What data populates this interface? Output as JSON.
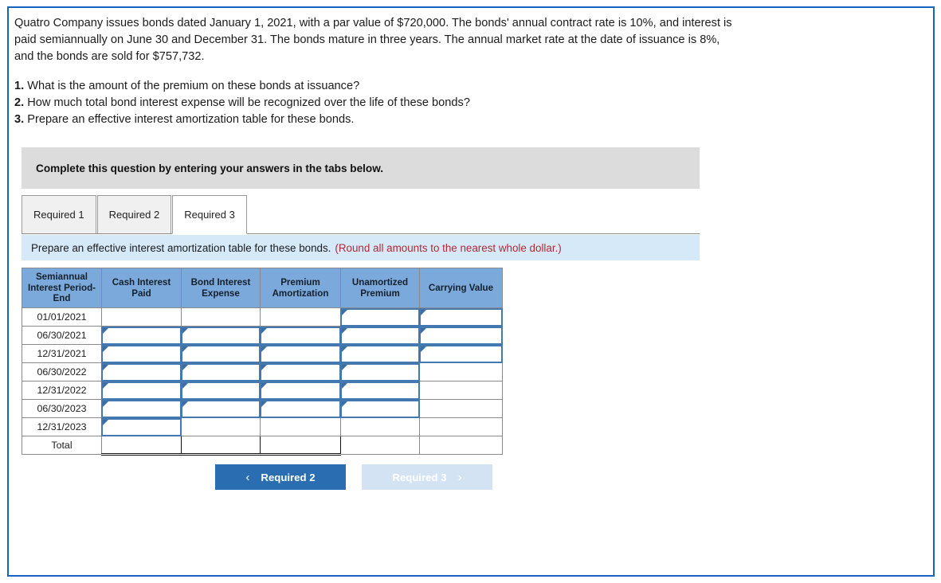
{
  "problem": {
    "statement": "Quatro Company issues bonds dated January 1, 2021, with a par value of $720,000. The bonds' annual contract rate is 10%, and interest is paid semiannually on June 30 and December 31. The bonds mature in three years. The annual market rate at the date of issuance is 8%, and the bonds are sold for $757,732.",
    "questions": [
      {
        "num": "1.",
        "text": "What is the amount of the premium on these bonds at issuance?"
      },
      {
        "num": "2.",
        "text": "How much total bond interest expense will be recognized over the life of these bonds?"
      },
      {
        "num": "3.",
        "text": "Prepare an effective interest amortization table for these bonds."
      }
    ]
  },
  "instruction_banner": {
    "text": "Complete this question by entering your answers in the tabs below."
  },
  "tabs": [
    {
      "label": "Required 1",
      "active": false
    },
    {
      "label": "Required 2",
      "active": false
    },
    {
      "label": "Required 3",
      "active": true
    }
  ],
  "info_bar": {
    "text": "Prepare an effective interest amortization table for these bonds.",
    "note": "(Round all amounts to the nearest whole dollar.)"
  },
  "table": {
    "headers": [
      "Semiannual Interest Period-End",
      "Cash Interest Paid",
      "Bond Interest Expense",
      "Premium Amortization",
      "Unamortized Premium",
      "Carrying Value"
    ],
    "rows": [
      {
        "period": "01/01/2021",
        "cells": [
          "",
          "",
          "",
          "",
          ""
        ],
        "inputs": [
          false,
          false,
          false,
          true,
          true
        ]
      },
      {
        "period": "06/30/2021",
        "cells": [
          "",
          "",
          "",
          "",
          ""
        ],
        "inputs": [
          true,
          true,
          true,
          true,
          true
        ]
      },
      {
        "period": "12/31/2021",
        "cells": [
          "",
          "",
          "",
          "",
          ""
        ],
        "inputs": [
          true,
          true,
          true,
          true,
          true
        ]
      },
      {
        "period": "06/30/2022",
        "cells": [
          "",
          "",
          "",
          "",
          ""
        ],
        "inputs": [
          true,
          true,
          true,
          true,
          false
        ]
      },
      {
        "period": "12/31/2022",
        "cells": [
          "",
          "",
          "",
          "",
          ""
        ],
        "inputs": [
          true,
          true,
          true,
          true,
          false
        ]
      },
      {
        "period": "06/30/2023",
        "cells": [
          "",
          "",
          "",
          "",
          ""
        ],
        "inputs": [
          true,
          true,
          true,
          true,
          false
        ]
      },
      {
        "period": "12/31/2023",
        "cells": [
          "",
          "",
          "",
          "",
          ""
        ],
        "inputs": [
          true,
          false,
          false,
          false,
          false
        ]
      },
      {
        "period": "Total",
        "cells": [
          "",
          "",
          "",
          "",
          ""
        ],
        "inputs": [
          false,
          false,
          false,
          false,
          false
        ],
        "total": true
      }
    ]
  },
  "navigation": {
    "prev_label": "Required 2",
    "prev_chevron": "‹",
    "next_label": "Required 3",
    "next_chevron": "›"
  },
  "colors": {
    "frame_border": "#1565c0",
    "header_blue": "#7BA9DC",
    "info_bar_blue": "#d6e9f8",
    "gray_bar": "#dcdcdc",
    "note_red": "#b02a33",
    "btn_active": "#2a6db0",
    "btn_disabled": "#d3e3f3",
    "input_border": "#4478B0"
  }
}
